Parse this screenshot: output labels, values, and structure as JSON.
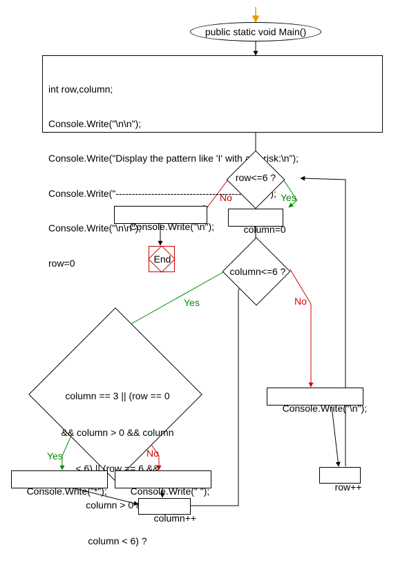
{
  "start": {
    "label": "public static void Main()"
  },
  "init": {
    "lines": [
      "int row,column;",
      "Console.Write(\"\\n\\n\");",
      "Console.Write(\"Display the pattern like 'I' with asterisk:\\n\");",
      "Console.Write(\"-----------------------------------------------\");",
      "Console.Write(\"\\n\\n\");",
      "row=0"
    ]
  },
  "dec_row": {
    "label": "row<=6 ?"
  },
  "write_nl_end": {
    "label": "Console.Write(\"\\n\");"
  },
  "col_init": {
    "label": "column=0"
  },
  "end": {
    "label": "End"
  },
  "dec_col": {
    "label": "column<=6 ?"
  },
  "dec_cond": {
    "lines": [
      "column == 3 || (row == 0",
      "&& column > 0 && column",
      "< 6) || (row == 6 &&",
      "column > 0 &&",
      "column < 6) ?"
    ]
  },
  "write_star": {
    "label": "Console.Write(\"*\");"
  },
  "write_space": {
    "label": "Console.Write(\" \");"
  },
  "col_inc": {
    "label": "column++"
  },
  "write_nl_row": {
    "label": "Console.Write(\"\\n\");"
  },
  "row_inc": {
    "label": "row++"
  },
  "labels": {
    "yes": "Yes",
    "no": "No"
  },
  "chart_data": {
    "type": "flowchart",
    "nodes": [
      {
        "id": "start",
        "kind": "terminator",
        "text": "public static void Main()"
      },
      {
        "id": "init",
        "kind": "process",
        "text": "int row,column;\nConsole.Write(\"\\n\\n\");\nConsole.Write(\"Display the pattern like 'I' with asterisk:\\n\");\nConsole.Write(\"-----------------------------------------------\");\nConsole.Write(\"\\n\\n\");\nrow=0"
      },
      {
        "id": "dec_row",
        "kind": "decision",
        "text": "row<=6 ?"
      },
      {
        "id": "write_nl_end",
        "kind": "process",
        "text": "Console.Write(\"\\n\");"
      },
      {
        "id": "col_init",
        "kind": "process",
        "text": "column=0"
      },
      {
        "id": "end",
        "kind": "end",
        "text": "End"
      },
      {
        "id": "dec_col",
        "kind": "decision",
        "text": "column<=6 ?"
      },
      {
        "id": "dec_cond",
        "kind": "decision",
        "text": "column == 3 || (row == 0 && column > 0 && column < 6) || (row == 6 && column > 0 && column < 6) ?"
      },
      {
        "id": "write_star",
        "kind": "process",
        "text": "Console.Write(\"*\");"
      },
      {
        "id": "write_space",
        "kind": "process",
        "text": "Console.Write(\" \");"
      },
      {
        "id": "col_inc",
        "kind": "process",
        "text": "column++"
      },
      {
        "id": "write_nl_row",
        "kind": "process",
        "text": "Console.Write(\"\\n\");"
      },
      {
        "id": "row_inc",
        "kind": "process",
        "text": "row++"
      }
    ],
    "edges": [
      {
        "from": "start",
        "to": "init"
      },
      {
        "from": "init",
        "to": "dec_row"
      },
      {
        "from": "dec_row",
        "to": "write_nl_end",
        "label": "No"
      },
      {
        "from": "dec_row",
        "to": "col_init",
        "label": "Yes"
      },
      {
        "from": "write_nl_end",
        "to": "end"
      },
      {
        "from": "col_init",
        "to": "dec_col"
      },
      {
        "from": "dec_col",
        "to": "dec_cond",
        "label": "Yes"
      },
      {
        "from": "dec_col",
        "to": "write_nl_row",
        "label": "No"
      },
      {
        "from": "dec_cond",
        "to": "write_star",
        "label": "Yes"
      },
      {
        "from": "dec_cond",
        "to": "write_space",
        "label": "No"
      },
      {
        "from": "write_star",
        "to": "col_inc"
      },
      {
        "from": "write_space",
        "to": "col_inc"
      },
      {
        "from": "col_inc",
        "to": "dec_col"
      },
      {
        "from": "write_nl_row",
        "to": "row_inc"
      },
      {
        "from": "row_inc",
        "to": "dec_row"
      }
    ]
  }
}
